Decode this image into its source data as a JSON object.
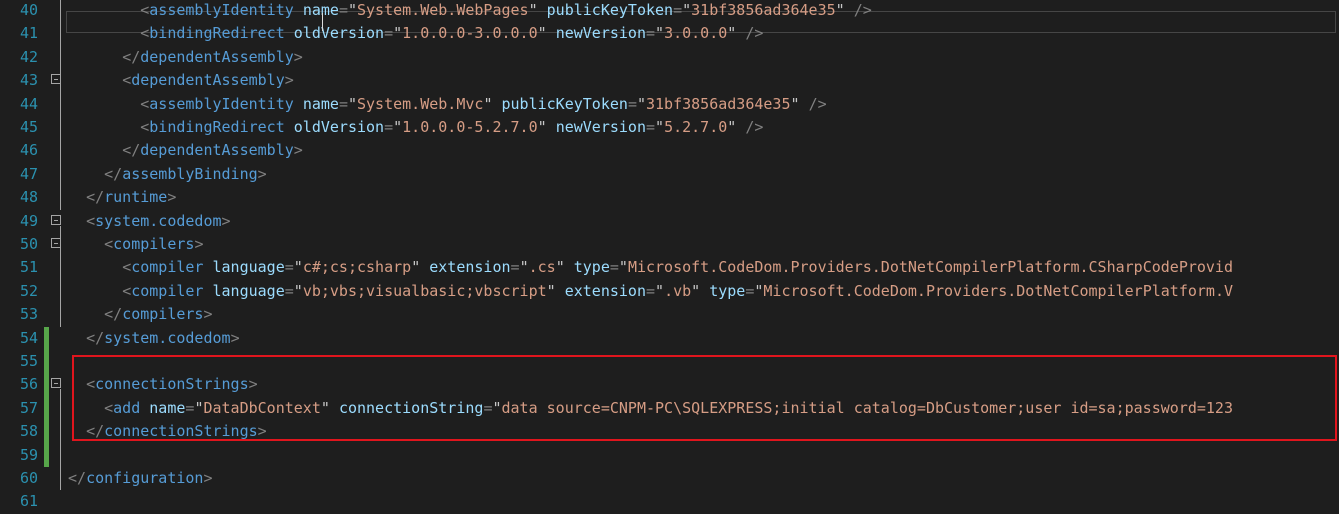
{
  "editor": {
    "language": "xml",
    "highlight_color": "#e0151d",
    "lines": [
      {
        "num": "40",
        "code": "        <assemblyIdentity name=\"System.Web.WebPages\" publicKeyToken=\"31bf3856ad364e35\" />"
      },
      {
        "num": "41",
        "code": "        <bindingRedirect oldVersion=\"1.0.0.0-3.0.0.0\" newVersion=\"3.0.0.0\" />"
      },
      {
        "num": "42",
        "code": "      </dependentAssembly>"
      },
      {
        "num": "43",
        "code": "      <dependentAssembly>"
      },
      {
        "num": "44",
        "code": "        <assemblyIdentity name=\"System.Web.Mvc\" publicKeyToken=\"31bf3856ad364e35\" />"
      },
      {
        "num": "45",
        "code": "        <bindingRedirect oldVersion=\"1.0.0.0-5.2.7.0\" newVersion=\"5.2.7.0\" />"
      },
      {
        "num": "46",
        "code": "      </dependentAssembly>"
      },
      {
        "num": "47",
        "code": "    </assemblyBinding>"
      },
      {
        "num": "48",
        "code": "  </runtime>"
      },
      {
        "num": "49",
        "code": "  <system.codedom>"
      },
      {
        "num": "50",
        "code": "    <compilers>"
      },
      {
        "num": "51",
        "code": "      <compiler language=\"c#;cs;csharp\" extension=\".cs\" type=\"Microsoft.CodeDom.Providers.DotNetCompilerPlatform.CSharpCodeProvid"
      },
      {
        "num": "52",
        "code": "      <compiler language=\"vb;vbs;visualbasic;vbscript\" extension=\".vb\" type=\"Microsoft.CodeDom.Providers.DotNetCompilerPlatform.V"
      },
      {
        "num": "53",
        "code": "    </compilers>"
      },
      {
        "num": "54",
        "code": "  </system.codedom>"
      },
      {
        "num": "55",
        "code": ""
      },
      {
        "num": "56",
        "code": "  <connectionStrings>"
      },
      {
        "num": "57",
        "code": "    <add name=\"DataDbContext\" connectionString=\"data source=CNPM-PC\\SQLEXPRESS;initial catalog=DbCustomer;user id=sa;password=123"
      },
      {
        "num": "58",
        "code": "  </connectionStrings>"
      },
      {
        "num": "59",
        "code": ""
      },
      {
        "num": "60",
        "code": "</configuration>"
      },
      {
        "num": "61",
        "code": ""
      }
    ]
  }
}
